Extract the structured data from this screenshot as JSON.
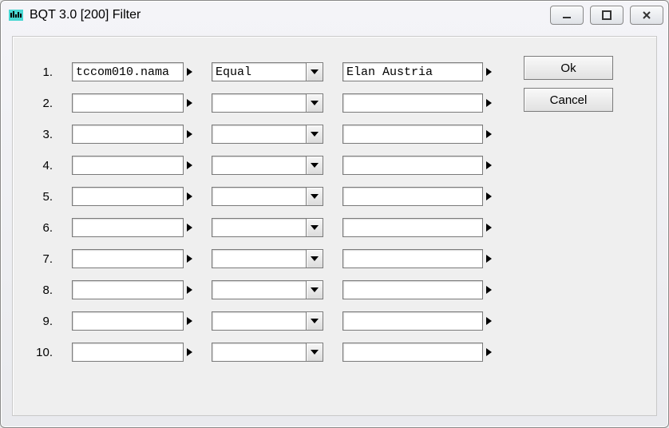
{
  "titlebar": {
    "title": "BQT 3.0 [200] Filter"
  },
  "buttons": {
    "ok": "Ok",
    "cancel": "Cancel"
  },
  "rows": [
    {
      "n": "1.",
      "field": "tccom010.nama",
      "operator": "Equal",
      "value": "Elan Austria"
    },
    {
      "n": "2.",
      "field": "",
      "operator": "",
      "value": ""
    },
    {
      "n": "3.",
      "field": "",
      "operator": "",
      "value": ""
    },
    {
      "n": "4.",
      "field": "",
      "operator": "",
      "value": ""
    },
    {
      "n": "5.",
      "field": "",
      "operator": "",
      "value": ""
    },
    {
      "n": "6.",
      "field": "",
      "operator": "",
      "value": ""
    },
    {
      "n": "7.",
      "field": "",
      "operator": "",
      "value": ""
    },
    {
      "n": "8.",
      "field": "",
      "operator": "",
      "value": ""
    },
    {
      "n": "9.",
      "field": "",
      "operator": "",
      "value": ""
    },
    {
      "n": "10.",
      "field": "",
      "operator": "",
      "value": ""
    }
  ]
}
